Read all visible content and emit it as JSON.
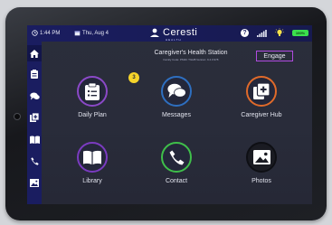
{
  "statusbar": {
    "time": "1:44 PM",
    "date": "Thu, Aug 4",
    "brand": "Ceresti",
    "brand_sub": "HEALTH",
    "battery": "100%",
    "help": "?"
  },
  "header": {
    "title": "Caregiver's Health Station",
    "subtitle": "Family Code: PM4C TGHB  Version: 9.4.0.978",
    "engage_label": "Engage"
  },
  "tiles": [
    {
      "label": "Daily Plan",
      "badge": "3",
      "icon": "clipboard-icon",
      "color": "#8b49c7"
    },
    {
      "label": "Messages",
      "icon": "chat-icon",
      "color": "#2e6fc0"
    },
    {
      "label": "Caregiver Hub",
      "icon": "add-document-icon",
      "color": "#e06a2a"
    },
    {
      "label": "Library",
      "icon": "book-icon",
      "color": "#7a3bc0"
    },
    {
      "label": "Contact",
      "icon": "phone-icon",
      "color": "#3fbf4a"
    },
    {
      "label": "Photos",
      "icon": "image-icon",
      "color": "#0e0f14"
    }
  ],
  "sidebar": [
    {
      "icon": "home-icon"
    },
    {
      "icon": "clipboard-icon"
    },
    {
      "icon": "chat-icon"
    },
    {
      "icon": "add-document-icon"
    },
    {
      "icon": "book-icon"
    },
    {
      "icon": "phone-icon"
    },
    {
      "icon": "image-icon"
    }
  ]
}
